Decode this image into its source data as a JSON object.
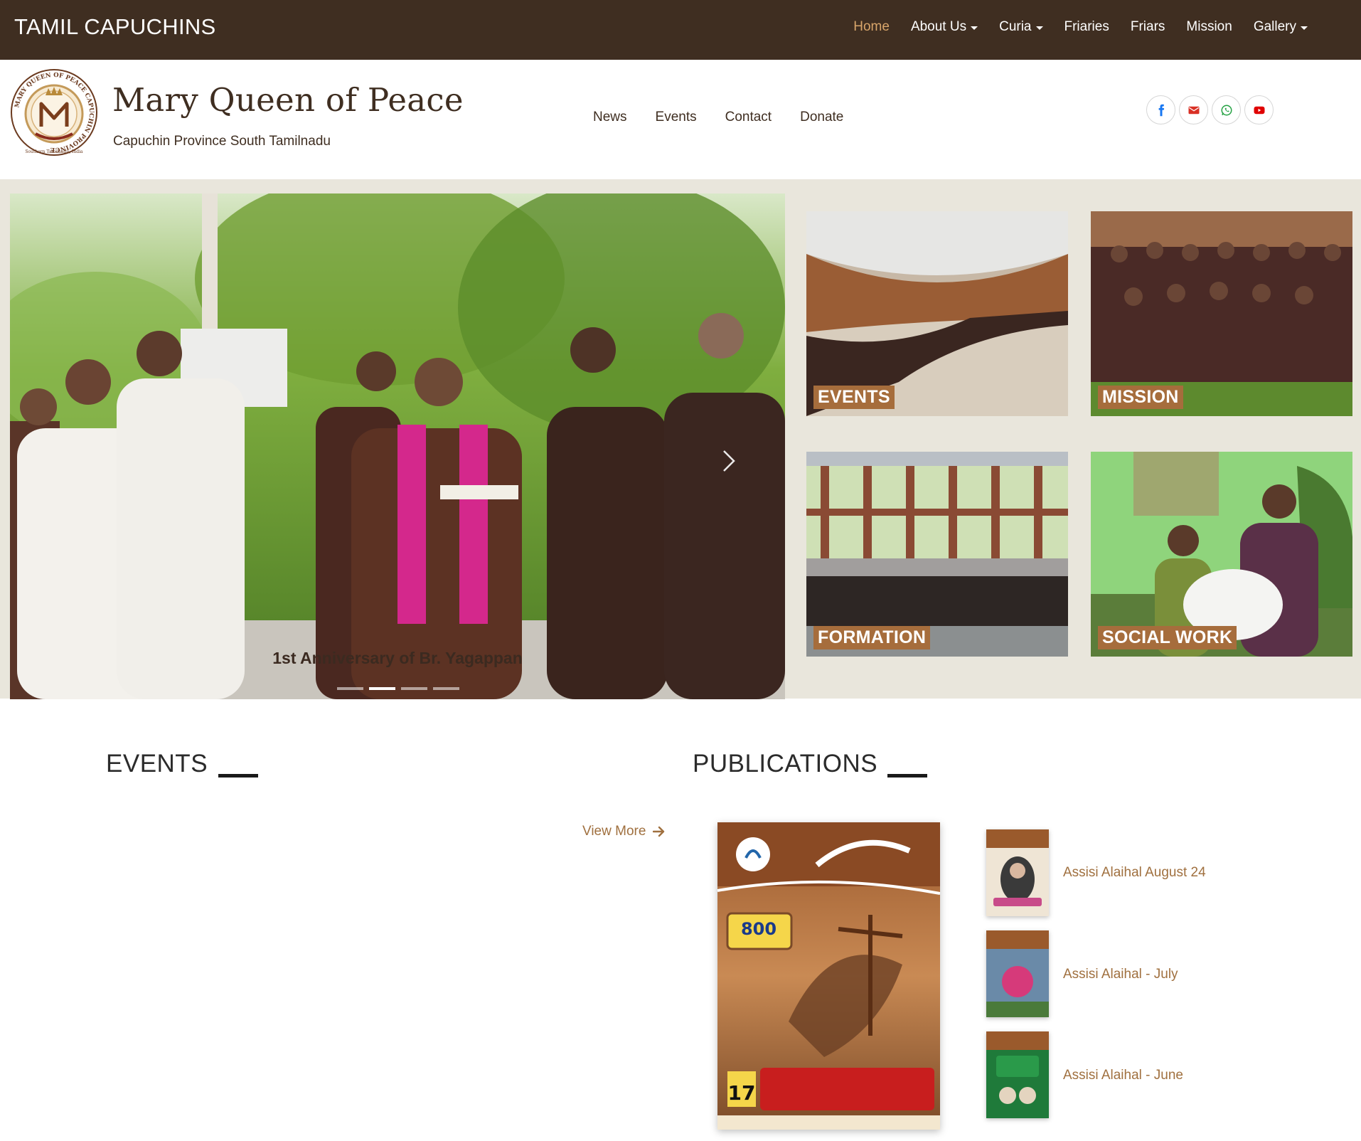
{
  "brand": "TAMIL CAPUCHINS",
  "topnav": [
    {
      "label": "Home",
      "active": true,
      "dropdown": false
    },
    {
      "label": "About Us",
      "active": false,
      "dropdown": true
    },
    {
      "label": "Curia",
      "active": false,
      "dropdown": true
    },
    {
      "label": "Friaries",
      "active": false,
      "dropdown": false
    },
    {
      "label": "Friars",
      "active": false,
      "dropdown": false
    },
    {
      "label": "Mission",
      "active": false,
      "dropdown": false
    },
    {
      "label": "Gallery",
      "active": false,
      "dropdown": true
    }
  ],
  "header": {
    "title": "Mary Queen of Peace",
    "subtitle": "Capuchin Province South Tamilnadu",
    "logo_ring_text": "MARY QUEEN OF PEACE CAPUCHIN PROVINCE",
    "logo_bottom_text": "Southern Tamilnadu, India",
    "subnav": [
      "News",
      "Events",
      "Contact",
      "Donate"
    ],
    "social": [
      {
        "icon": "facebook-icon",
        "color": "#1877f2"
      },
      {
        "icon": "email-icon",
        "color": "#d93025"
      },
      {
        "icon": "whatsapp-icon",
        "color": "#25a244"
      },
      {
        "icon": "youtube-icon",
        "color": "#e00000"
      }
    ]
  },
  "slider": {
    "caption": "1st Anniversary of Br. Yagappan",
    "slide_count": 4,
    "active_index": 1
  },
  "tiles": {
    "events": "EVENTS",
    "mission": "MISSION",
    "formation": "FORMATION",
    "social_work": "SOCIAL WORK"
  },
  "events_section": {
    "title": "EVENTS",
    "view_more": "View More"
  },
  "publications": {
    "title": "PUBLICATIONS",
    "featured_cover": {
      "number_badge": "800",
      "date_number": "17"
    },
    "items": [
      {
        "title": "Assisi Alaihal August 24"
      },
      {
        "title": "Assisi Alaihal - July"
      },
      {
        "title": "Assisi Alaihal - June"
      }
    ]
  },
  "colors": {
    "navbar": "#3f2e21",
    "accent": "#d8a56a",
    "label_bg": "#a66d3c",
    "link": "#a0703f",
    "hero_bg": "#e9e6dc"
  }
}
